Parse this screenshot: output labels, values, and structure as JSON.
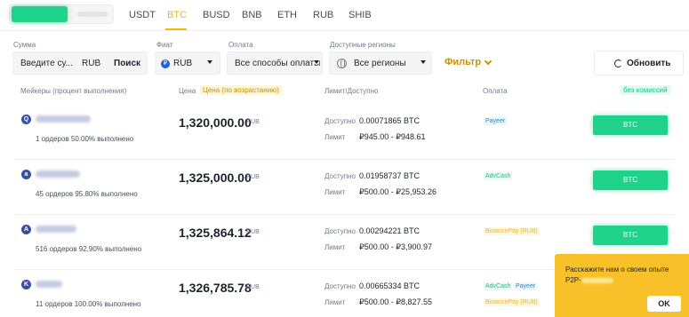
{
  "tabs": [
    "USDT",
    "BTC",
    "BUSD",
    "BNB",
    "ETH",
    "RUB",
    "SHIB"
  ],
  "active_tab": "BTC",
  "filters": {
    "amount_label": "Сумма",
    "amount_placeholder": "Введите су...",
    "amount_currency": "RUB",
    "search_label": "Поиск",
    "fiat_label": "Фиат",
    "fiat_value": "RUB",
    "fiat_icon": "₽",
    "payment_label": "Оплата",
    "payment_value": "Все способы оплаты",
    "regions_label": "Доступные регионы",
    "regions_value": "Все регионы",
    "filter_label": "Фильтр",
    "refresh_label": "Обновить"
  },
  "table": {
    "col_makers": "Мейкеры (процент выполнения)",
    "col_price": "Цена",
    "price_sort": "Цена (по возрастанию)",
    "col_limit": "Лимит/Доступно",
    "col_payment": "Оплата",
    "no_fee": "без комиссий",
    "available_label": "Доступно",
    "limit_label": "Лимит",
    "buy_label": "BTC",
    "rows": [
      {
        "avatar": "Q",
        "orders": "1 ордеров   50.00% выполнено",
        "price": "1,320,000.00",
        "unit": "RUB",
        "available": "0.00071865 BTC",
        "limit": "₽945.00 - ₽948.61",
        "payments": [
          "Payeer"
        ]
      },
      {
        "avatar": "a",
        "orders": "45 ордеров   95.80% выполнено",
        "price": "1,325,000.00",
        "unit": "RUB",
        "available": "0.01958737 BTC",
        "limit": "₽500.00 - ₽25,953.26",
        "payments": [
          "AdvCash"
        ]
      },
      {
        "avatar": "A",
        "orders": "516 ордеров   92.90% выполнено",
        "price": "1,325,864.12",
        "unit": "RUB",
        "available": "0.00294221 BTC",
        "limit": "₽500.00 - ₽3,900.97",
        "payments": [
          "BinancePay (RUB)"
        ]
      },
      {
        "avatar": "K",
        "orders": "11 ордеров   100.00% выполнено",
        "price": "1,326,785.78",
        "unit": "RUB",
        "available": "0.00665334 BTC",
        "limit": "₽500.00 - ₽8,827.55",
        "payments": [
          "AdvCash",
          "Payeer",
          "BinancePay (RUB)"
        ]
      }
    ]
  },
  "popup": {
    "message": "Расскажите нам о своем опыте P2P-",
    "ok": "OK"
  },
  "colors": {
    "accent": "#f0b90b",
    "buy": "#1fd38a",
    "popup_bg": "#f8c029"
  }
}
